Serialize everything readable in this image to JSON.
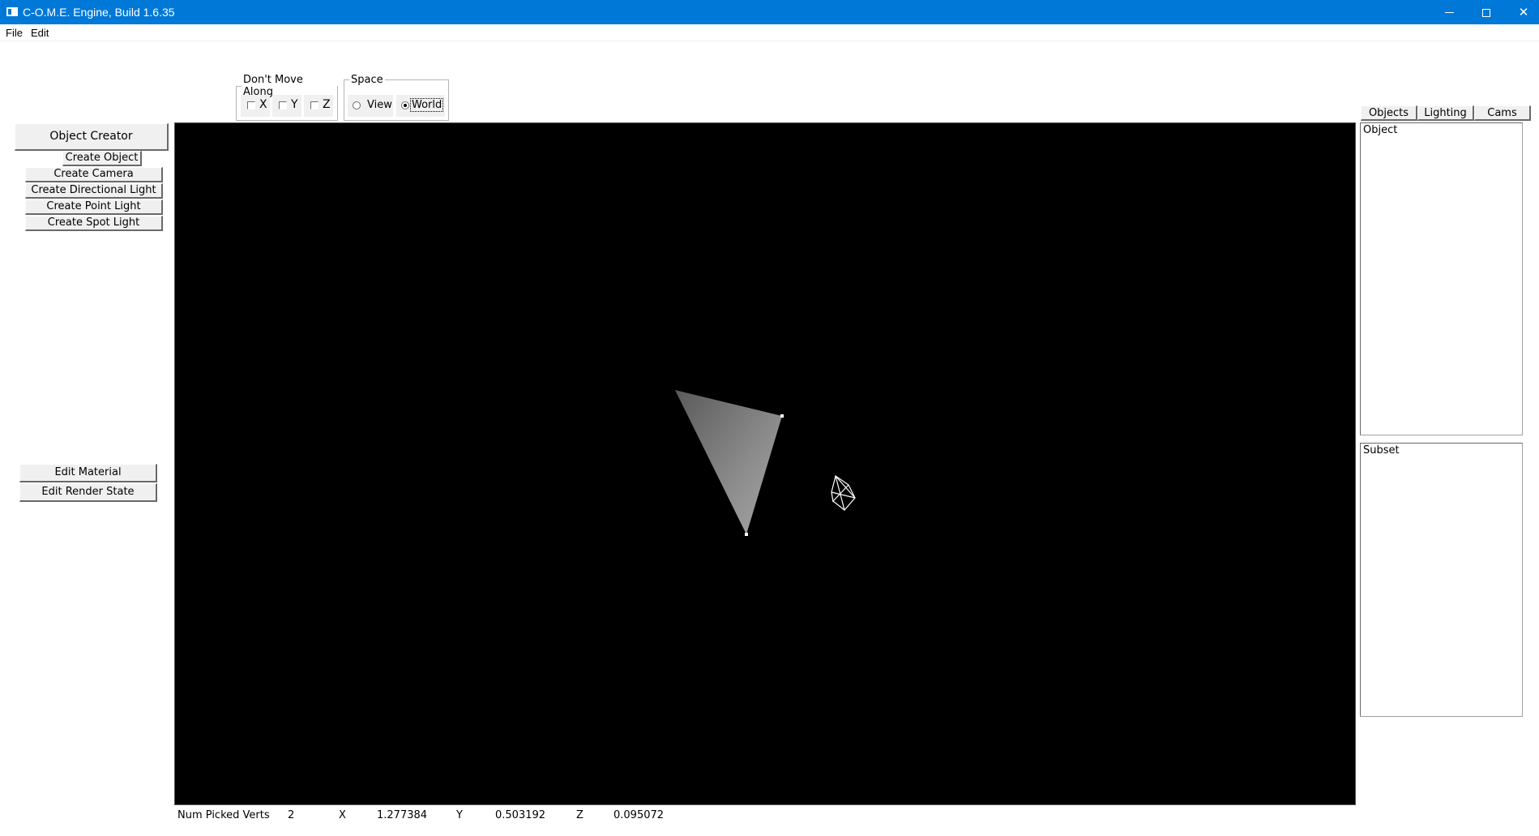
{
  "window": {
    "title": "C-O.M.E. Engine, Build 1.6.35",
    "controls": {
      "minimize": "minimize",
      "maximize": "maximize",
      "close": "✕"
    }
  },
  "menu": {
    "file": "File",
    "edit": "Edit"
  },
  "toolbar": {
    "dont_move_along": {
      "legend": "Don't Move Along",
      "x": {
        "label": "X",
        "checked": false
      },
      "y": {
        "label": "Y",
        "checked": false
      },
      "z": {
        "label": "Z",
        "checked": false
      }
    },
    "space": {
      "legend": "Space",
      "view": {
        "label": "View",
        "selected": false
      },
      "world": {
        "label": "World",
        "selected": true
      }
    }
  },
  "left_panel": {
    "object_creator": "Object Creator",
    "create_object": "Create Object",
    "create_camera": "Create Camera",
    "create_directional_light": "Create Directional Light",
    "create_point_light": "Create Point Light",
    "create_spot_light": "Create Spot Light",
    "edit_material": "Edit Material",
    "edit_render_state": "Edit Render State"
  },
  "right_panel": {
    "tabs": [
      "Objects",
      "Lighting",
      "Cams"
    ],
    "object_list_header": "Object",
    "subset_list_header": "Subset"
  },
  "status": {
    "label": "Num Picked Verts",
    "count": "2",
    "x_label": "X",
    "x_value": "1.277384",
    "y_label": "Y",
    "y_value": "0.503192",
    "z_label": "Z",
    "z_value": "0.095072"
  },
  "colors": {
    "titlebar": "#0078d7",
    "viewport_background": "#000000",
    "triangle_fill": "#8c8c8c",
    "wireframe": "#ffffff"
  }
}
